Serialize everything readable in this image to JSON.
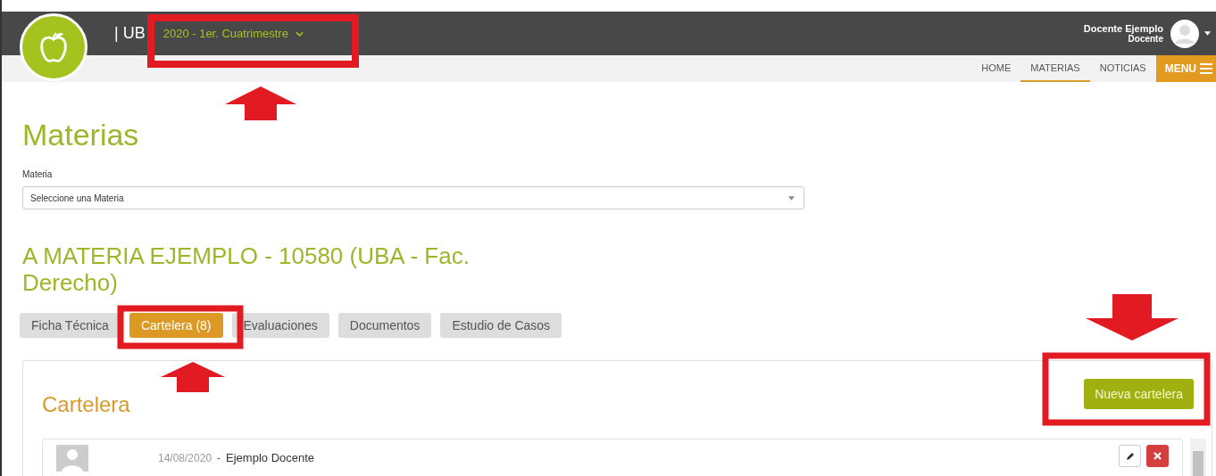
{
  "header": {
    "brand": "| UB",
    "period": "2020 - 1er. Cuatrimestre",
    "user_name": "Docente Ejemplo",
    "user_role": "Docente"
  },
  "nav": [
    {
      "label": "HOME",
      "selected": false
    },
    {
      "label": "MATERIAS",
      "selected": true
    },
    {
      "label": "NOTICIAS",
      "selected": false
    }
  ],
  "menu_button": "MENU",
  "page_title": "Materias",
  "materia_field": {
    "label": "Materia",
    "value": "Seleccione una Materia"
  },
  "course_title": "A MATERIA EJEMPLO - 10580 (UBA - Fac. Derecho)",
  "tabs": [
    {
      "label": "Ficha Técnica",
      "selected": false
    },
    {
      "label": "Cartelera (8)",
      "selected": true
    },
    {
      "label": "Evaluaciones",
      "selected": false
    },
    {
      "label": "Documentos",
      "selected": false
    },
    {
      "label": "Estudio de Casos",
      "selected": false
    }
  ],
  "panel": {
    "title": "Cartelera",
    "new_button": "Nueva cartelera",
    "posts": [
      {
        "date": "14/08/2020",
        "separator": "-",
        "author": "Ejemplo Docente"
      }
    ]
  }
}
